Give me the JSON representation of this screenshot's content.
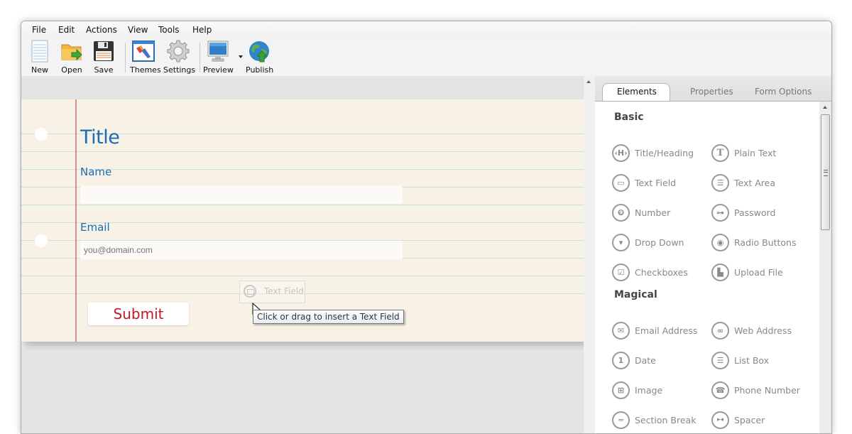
{
  "menu": [
    "File",
    "Edit",
    "Actions",
    "View",
    "Tools",
    "Help"
  ],
  "toolbar": {
    "new": "New",
    "open": "Open",
    "save": "Save",
    "themes": "Themes",
    "settings": "Settings",
    "preview": "Preview",
    "publish": "Publish"
  },
  "form": {
    "title": "Title",
    "fields": [
      {
        "label": "Name",
        "value": "",
        "placeholder": ""
      },
      {
        "label": "Email",
        "value": "",
        "placeholder": "you@domain.com"
      }
    ],
    "submit_label": "Submit"
  },
  "drag": {
    "ghost_label": "Text Field",
    "tooltip": "Click or drag to insert a Text Field"
  },
  "panel": {
    "tabs": [
      "Elements",
      "Properties",
      "Form Options"
    ],
    "active_tab": "Elements",
    "sections": [
      {
        "heading": "Basic",
        "items": [
          {
            "label": "Title/Heading",
            "icon": "heading-icon"
          },
          {
            "label": "Plain Text",
            "icon": "plain-text-icon"
          },
          {
            "label": "Text Field",
            "icon": "text-field-icon"
          },
          {
            "label": "Text Area",
            "icon": "text-area-icon"
          },
          {
            "label": "Number",
            "icon": "number-icon"
          },
          {
            "label": "Password",
            "icon": "key-icon"
          },
          {
            "label": "Drop Down",
            "icon": "dropdown-icon"
          },
          {
            "label": "Radio Buttons",
            "icon": "radio-icon"
          },
          {
            "label": "Checkboxes",
            "icon": "checkbox-icon"
          },
          {
            "label": "Upload File",
            "icon": "upload-file-icon"
          }
        ]
      },
      {
        "heading": "Magical",
        "items": [
          {
            "label": "Email Address",
            "icon": "envelope-icon"
          },
          {
            "label": "Web Address",
            "icon": "link-icon"
          },
          {
            "label": "Date",
            "icon": "calendar-icon"
          },
          {
            "label": "List Box",
            "icon": "list-box-icon"
          },
          {
            "label": "Image",
            "icon": "image-icon"
          },
          {
            "label": "Phone Number",
            "icon": "phone-icon"
          },
          {
            "label": "Section Break",
            "icon": "section-break-icon"
          },
          {
            "label": "Spacer",
            "icon": "spacer-icon"
          }
        ]
      }
    ]
  }
}
